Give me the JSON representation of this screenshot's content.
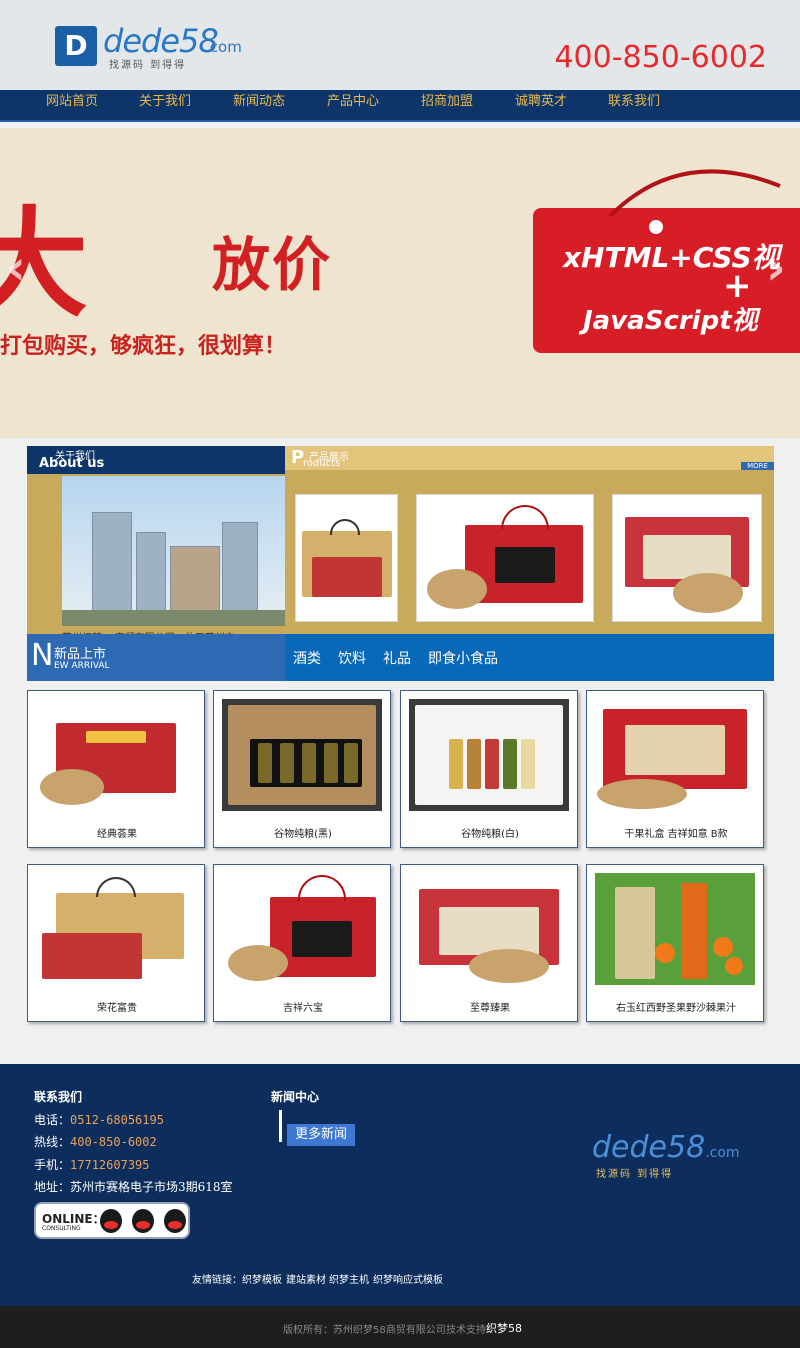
{
  "header": {
    "logo_mark": "D",
    "logo_text": "dede58",
    "logo_com": ".com",
    "logo_slogan": "找源码 到得得",
    "phone": "400-850-6002"
  },
  "nav": {
    "items": [
      "网站首页",
      "关于我们",
      "新闻动态",
      "产品中心",
      "招商加盟",
      "诚聘英才",
      "联系我们"
    ]
  },
  "banner": {
    "big_char": "大",
    "title": "放价",
    "subtitle": "打包购买，够疯狂，很划算！",
    "tag_line1": "xHTML+CSS视",
    "tag_plus": "+",
    "tag_line2": "JavaScript视",
    "prev_arrow": "‹",
    "next_arrow": "›"
  },
  "about": {
    "heading_cn": "关于我们",
    "heading_en": "About us",
    "text": "苏州织梦58商贸有限公司，位于苏州市"
  },
  "products_panel": {
    "heading_p": "P",
    "heading_cn": "产品展示",
    "heading_en": "roducts",
    "more": "MORE"
  },
  "new_arrival": {
    "n": "N",
    "cn": "新品上市",
    "en": "EW ARRIVAL"
  },
  "categories": [
    "酒类",
    "饮料",
    "礼品",
    "即食小食品"
  ],
  "products": [
    {
      "name": "经典荟果"
    },
    {
      "name": "谷物纯粮(黑)"
    },
    {
      "name": "谷物纯粮(白)"
    },
    {
      "name": "干果礼盒 吉祥如意 B款"
    },
    {
      "name": "荣花富贵"
    },
    {
      "name": "吉祥六宝"
    },
    {
      "name": "至尊臻果"
    },
    {
      "name": "右玉红西野圣果野沙棘果汁"
    }
  ],
  "footer": {
    "contact_title": "联系我们",
    "tel_label": "电话：",
    "tel": "0512-68056195",
    "hotline_label": "热线：",
    "hotline": "400-850-6002",
    "mobile_label": "手机：",
    "mobile": "17712607395",
    "address_label": "地址：",
    "address": "苏州市赛格电子市场3期618室",
    "online_title": "ONLINE",
    "online_colon": "：",
    "online_sub": "CONSULTING",
    "news_title": "新闻中心",
    "more_news": "更多新闻",
    "logo_text": "dede58",
    "logo_com": ".com",
    "logo_slogan": "找源码 到得得",
    "links_label": "友情链接：",
    "links": [
      "织梦模板",
      "建站素材",
      "织梦主机",
      "织梦响应式模板"
    ]
  },
  "copyright": {
    "text": "版权所有：苏州织梦58商贸有限公司",
    "support_label": "技术支持:",
    "support": "织梦58"
  },
  "colors": {
    "nav_bg": "#0e3569",
    "nav_text": "#e9b84d",
    "phone": "#e8292b",
    "brand_blue": "#2a78c4",
    "footer_bg": "#0d2e5c"
  }
}
